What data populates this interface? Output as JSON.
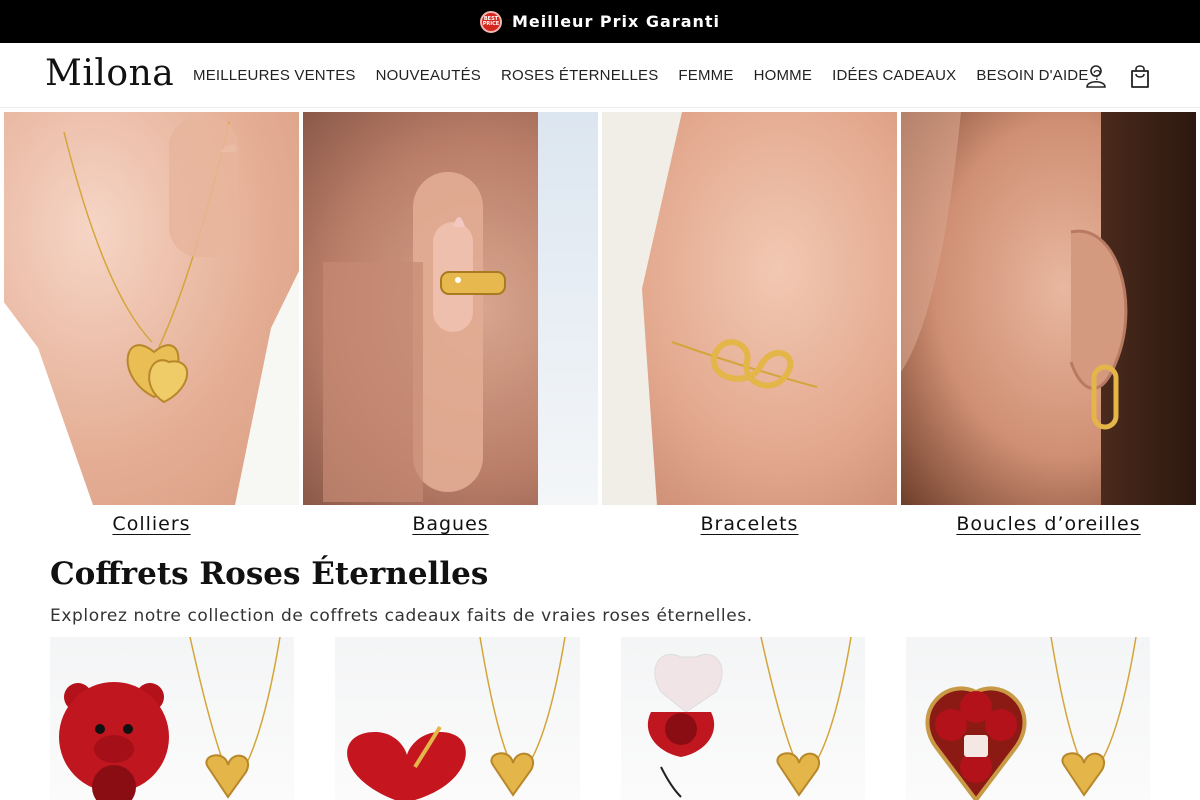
{
  "announcement": {
    "badge_text": "BEST PRICE",
    "text": "Meilleur Prix Garanti"
  },
  "header": {
    "logo": "Milona",
    "nav": [
      "MEILLEURES VENTES",
      "NOUVEAUTÉS",
      "ROSES ÉTERNELLES",
      "FEMME",
      "HOMME",
      "IDÉES CADEAUX",
      "BESOIN D'AIDE ?"
    ],
    "icons": [
      "account-icon",
      "shopping-bag-icon"
    ]
  },
  "categories": [
    {
      "label": "Colliers"
    },
    {
      "label": "Bagues"
    },
    {
      "label": "Bracelets"
    },
    {
      "label": "Boucles d’oreilles"
    }
  ],
  "section": {
    "title": "Coffrets Roses Éternelles",
    "subtitle": "Explorez notre collection de coffrets cadeaux faits de vraies roses éternelles."
  },
  "products": [
    {
      "name": "teddy-bear-rose-necklace"
    },
    {
      "name": "heart-arrow-necklace"
    },
    {
      "name": "heart-rose-box-necklace"
    },
    {
      "name": "quad-rose-heart-box-necklace"
    }
  ],
  "colors": {
    "announcement_bg": "#000000",
    "badge_red": "#d7261e",
    "gold": "#d4a53a",
    "rose_red": "#b3121b"
  }
}
